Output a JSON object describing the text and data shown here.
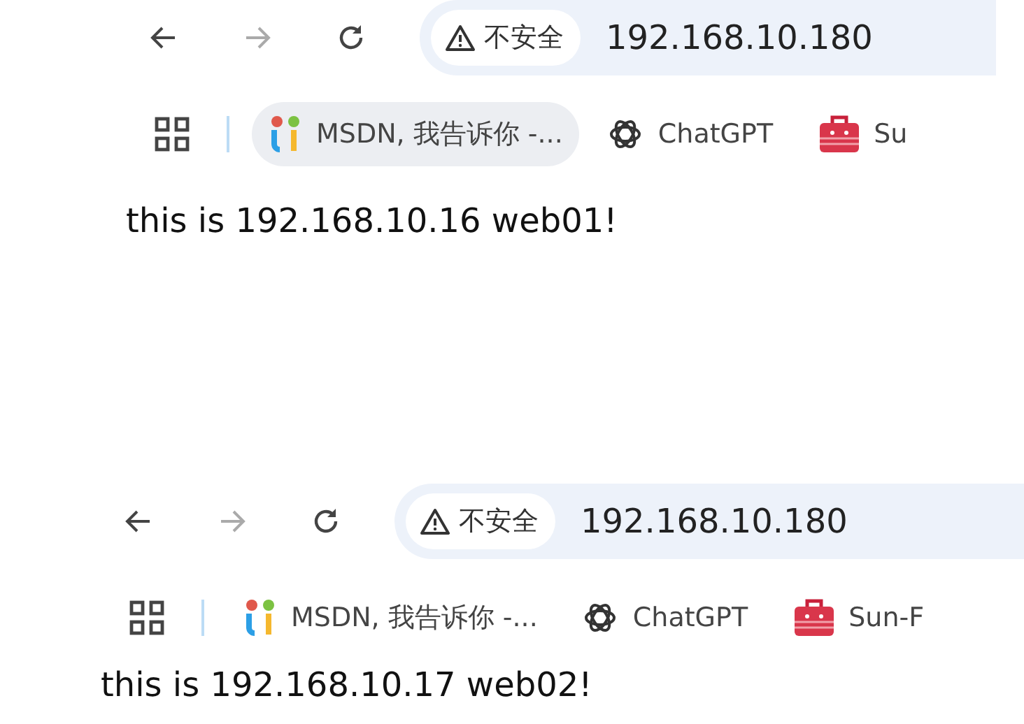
{
  "screenshots": [
    {
      "nav_buttons": [
        {
          "kind": "back",
          "disabled": false
        },
        {
          "kind": "forward",
          "disabled": true
        },
        {
          "kind": "reload",
          "disabled": false
        }
      ],
      "security_label": "不安全",
      "url": "192.168.10.180",
      "bookmarks": [
        {
          "kind": "msdn",
          "label": "MSDN, 我告诉你 -...",
          "highlighted": true
        },
        {
          "kind": "chatgpt",
          "label": "ChatGPT",
          "highlighted": false
        },
        {
          "kind": "toolbox",
          "label": "Su",
          "highlighted": false
        }
      ],
      "page_text": "this is 192.168.10.16 web01!"
    },
    {
      "nav_buttons": [
        {
          "kind": "back",
          "disabled": false
        },
        {
          "kind": "forward",
          "disabled": true
        },
        {
          "kind": "reload",
          "disabled": false
        }
      ],
      "security_label": "不安全",
      "url": "192.168.10.180",
      "bookmarks": [
        {
          "kind": "msdn",
          "label": "MSDN, 我告诉你 -...",
          "highlighted": false
        },
        {
          "kind": "chatgpt",
          "label": "ChatGPT",
          "highlighted": false
        },
        {
          "kind": "toolbox",
          "label": "Sun-F",
          "highlighted": false
        }
      ],
      "page_text": "this is 192.168.10.17 web02!"
    }
  ]
}
